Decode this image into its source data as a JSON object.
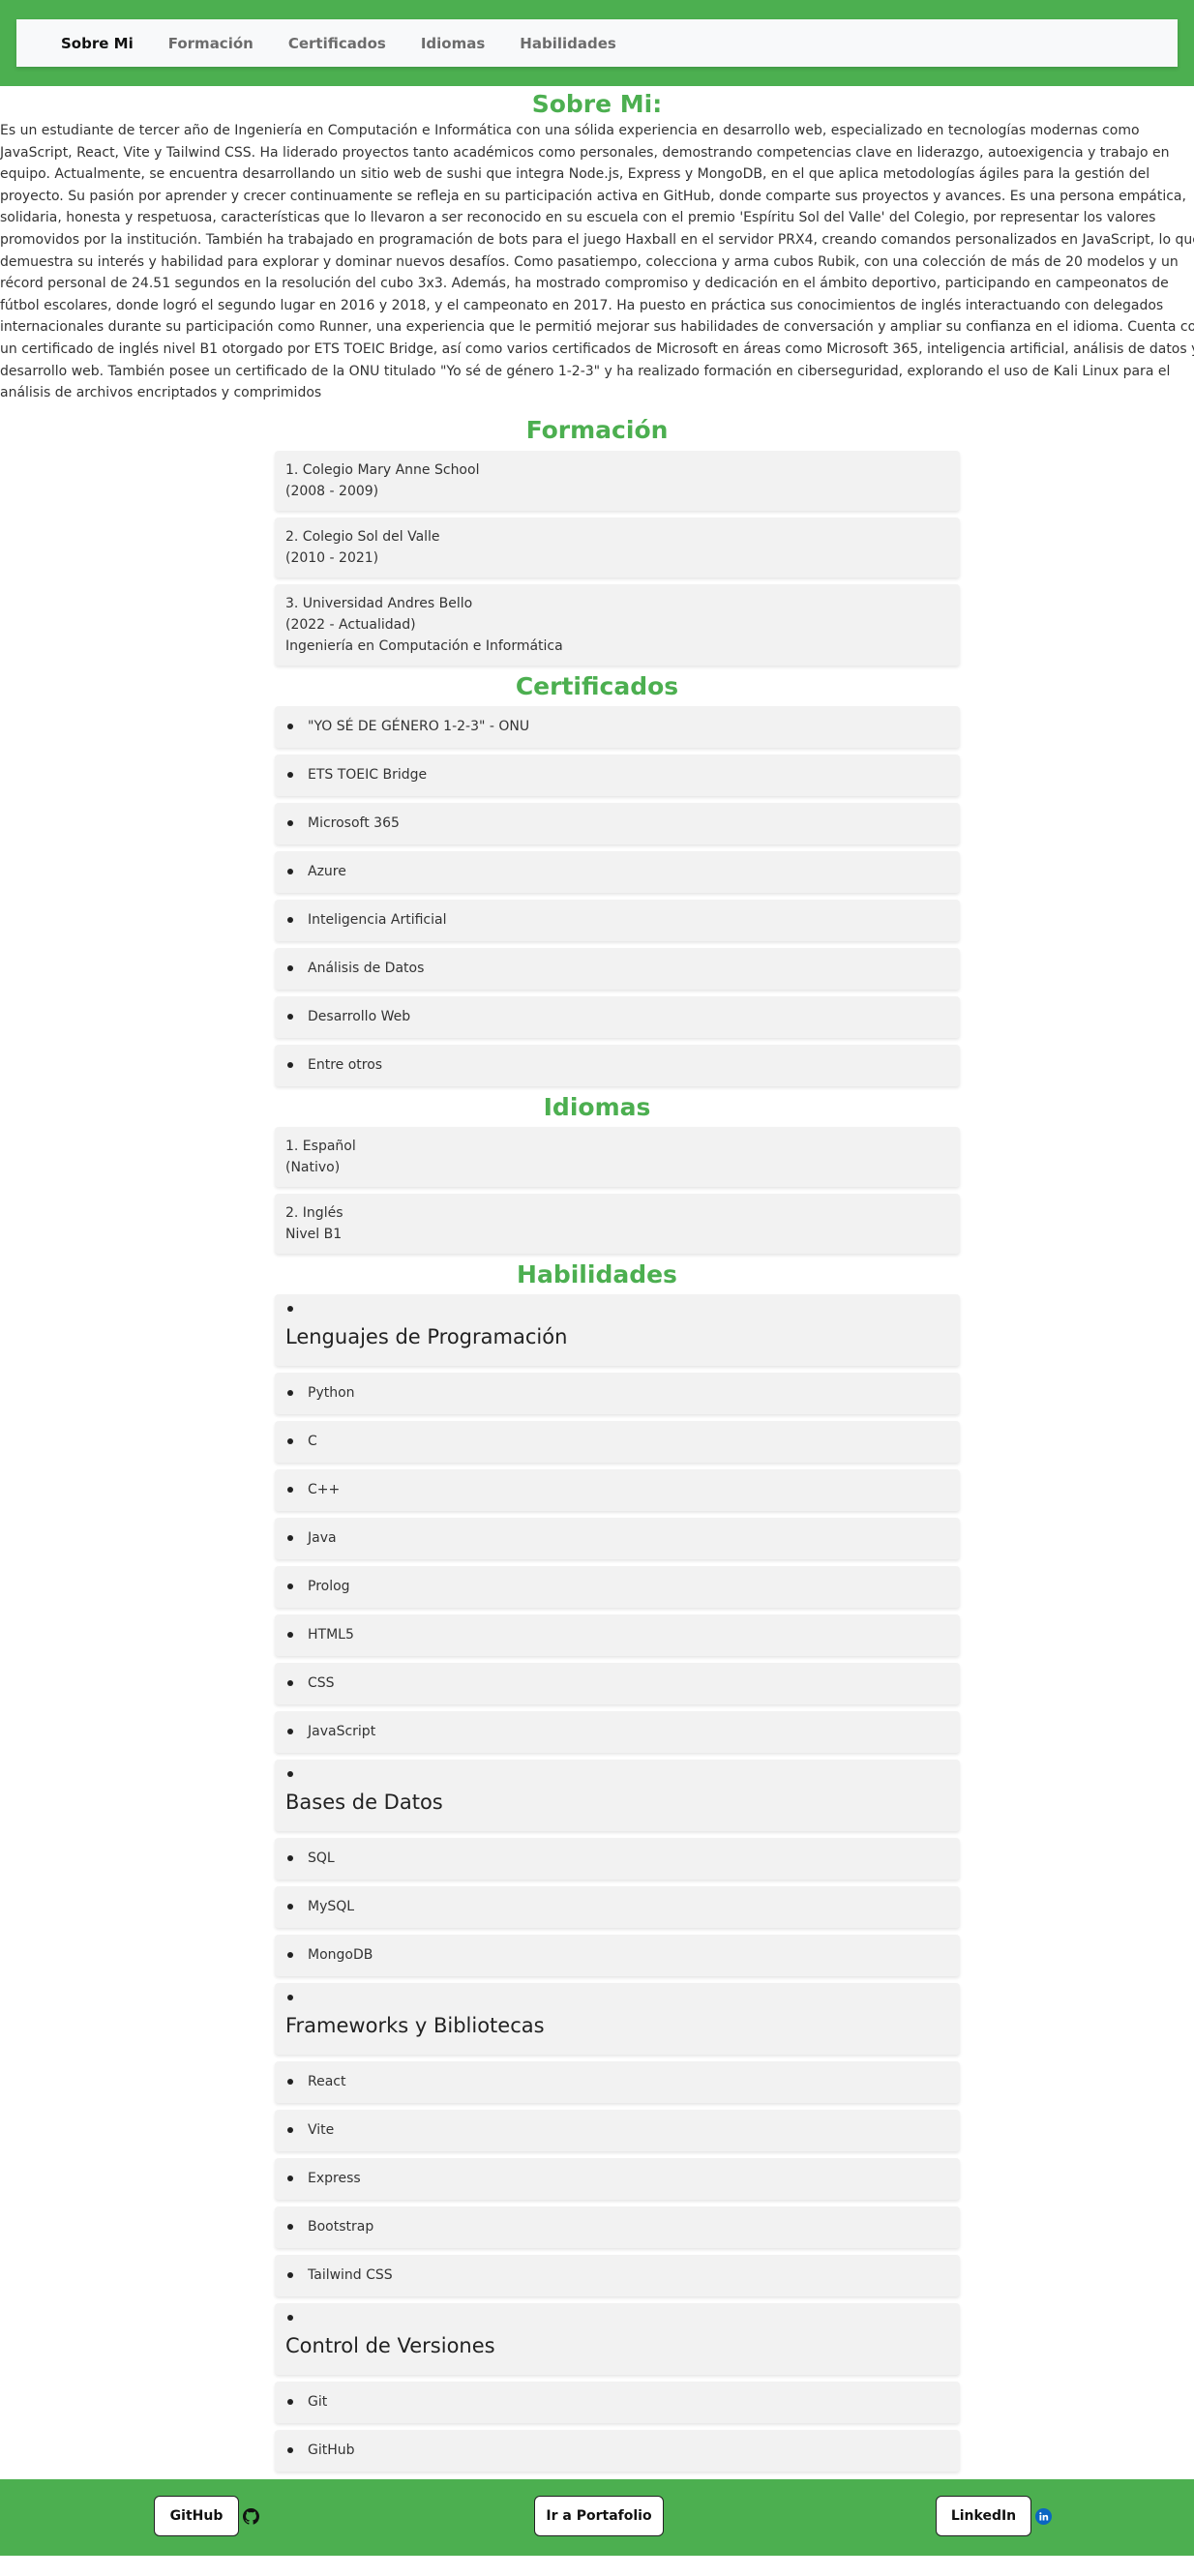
{
  "nav": {
    "items": [
      "Sobre Mi",
      "Formación",
      "Certificados",
      "Idiomas",
      "Habilidades"
    ]
  },
  "about": {
    "title": "Sobre Mi:",
    "text": "Es un estudiante de tercer año de Ingeniería en Computación e Informática con una sólida experiencia en desarrollo web, especializado en tecnologías modernas como JavaScript, React, Vite y Tailwind CSS. Ha liderado proyectos tanto académicos como personales, demostrando competencias clave en liderazgo, autoexigencia y trabajo en equipo. Actualmente, se encuentra desarrollando un sitio web de sushi que integra Node.js, Express y MongoDB, en el que aplica metodologías ágiles para la gestión del proyecto. Su pasión por aprender y crecer continuamente se refleja en su participación activa en GitHub, donde comparte sus proyectos y avances. Es una persona empática, solidaria, honesta y respetuosa, características que lo llevaron a ser reconocido en su escuela con el premio 'Espíritu Sol del Valle' del Colegio, por representar los valores promovidos por la institución. También ha trabajado en programación de bots para el juego Haxball en el servidor PRX4, creando comandos personalizados en JavaScript, lo que demuestra su interés y habilidad para explorar y dominar nuevos desafíos. Como pasatiempo, colecciona y arma cubos Rubik, con una colección de más de 20 modelos y un récord personal de 24.51 segundos en la resolución del cubo 3x3. Además, ha mostrado compromiso y dedicación en el ámbito deportivo, participando en campeonatos de fútbol escolares, donde logró el segundo lugar en 2016 y 2018, y el campeonato en 2017. Ha puesto en práctica sus conocimientos de inglés interactuando con delegados internacionales durante su participación como Runner, una experiencia que le permitió mejorar sus habilidades de conversación y ampliar su confianza en el idioma. Cuenta con un certificado de inglés nivel B1 otorgado por ETS TOEIC Bridge, así como varios certificados de Microsoft en áreas como Microsoft 365, inteligencia artificial, análisis de datos y desarrollo web. También posee un certificado de la ONU titulado \"Yo sé de género 1-2-3\" y ha realizado formación en ciberseguridad, explorando el uso de Kali Linux para el análisis de archivos encriptados y comprimidos"
  },
  "formacion": {
    "title": "Formación",
    "items": [
      {
        "lines": [
          "1. Colegio Mary Anne School",
          "(2008 - 2009)"
        ]
      },
      {
        "lines": [
          "2. Colegio Sol del Valle",
          "(2010 - 2021)"
        ]
      },
      {
        "lines": [
          "3. Universidad Andres Bello",
          "(2022 - Actualidad)",
          "Ingeniería en Computación e Informática"
        ]
      }
    ]
  },
  "certificados": {
    "title": "Certificados",
    "items": [
      "\"YO SÉ DE GÉNERO 1-2-3\" - ONU",
      "ETS TOEIC Bridge",
      "Microsoft 365",
      "Azure",
      "Inteligencia Artificial",
      "Análisis de Datos",
      "Desarrollo Web",
      "Entre otros"
    ]
  },
  "idiomas": {
    "title": "Idiomas",
    "items": [
      {
        "lines": [
          "1. Español",
          "(Nativo)"
        ]
      },
      {
        "lines": [
          "2. Inglés",
          "Nivel B1"
        ]
      }
    ]
  },
  "habilidades": {
    "title": "Habilidades",
    "groups": [
      {
        "title": "Lenguajes de Programación",
        "items": [
          "Python",
          "C",
          "C++",
          "Java",
          "Prolog",
          "HTML5",
          "CSS",
          "JavaScript"
        ]
      },
      {
        "title": "Bases de Datos",
        "items": [
          "SQL",
          "MySQL",
          "MongoDB"
        ]
      },
      {
        "title": "Frameworks y Bibliotecas",
        "items": [
          "React",
          "Vite",
          "Express",
          "Bootstrap",
          "Tailwind CSS"
        ]
      },
      {
        "title": "Control de Versiones",
        "items": [
          "Git",
          "GitHub"
        ]
      }
    ]
  },
  "footer": {
    "github_label": "GitHub",
    "portfolio_label": "Ir a Portafolio",
    "linkedin_label": "LinkedIn",
    "icons": {
      "github": "github-icon",
      "linkedin": "linkedin-icon"
    },
    "colors": {
      "green": "#4caf50",
      "linkedin_blue": "#0a66c2"
    }
  }
}
